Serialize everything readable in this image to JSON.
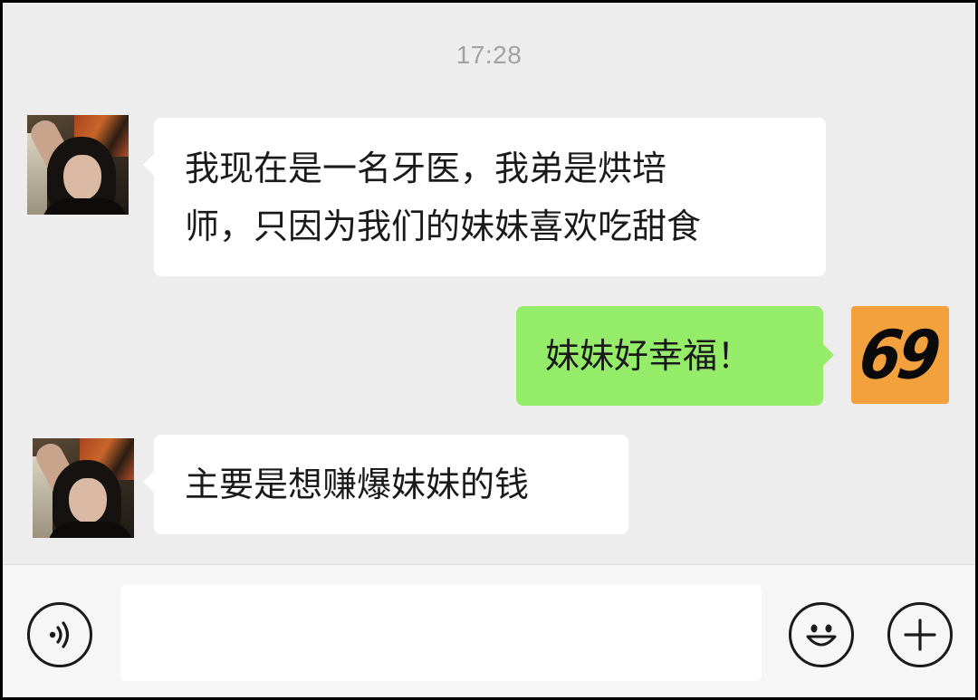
{
  "chat": {
    "timestamp": "17:28",
    "messages": [
      {
        "side": "left",
        "lines": [
          "我现在是一名牙医，我弟是烘培",
          "师，只因为我们的妹妹喜欢吃甜食"
        ]
      },
      {
        "side": "right",
        "lines": [
          "妹妹好幸福！"
        ]
      },
      {
        "side": "left",
        "lines": [
          "主要是想赚爆妹妹的钱"
        ]
      }
    ],
    "self_avatar_text": "69"
  },
  "input_bar": {
    "message_value": "",
    "icons": {
      "voice": "voice-icon",
      "emoji": "emoji-icon",
      "more": "plus-icon"
    }
  },
  "colors": {
    "background": "#ededed",
    "bubble_in": "#ffffff",
    "bubble_out": "#95ec69",
    "self_avatar": "#f3a13c"
  }
}
